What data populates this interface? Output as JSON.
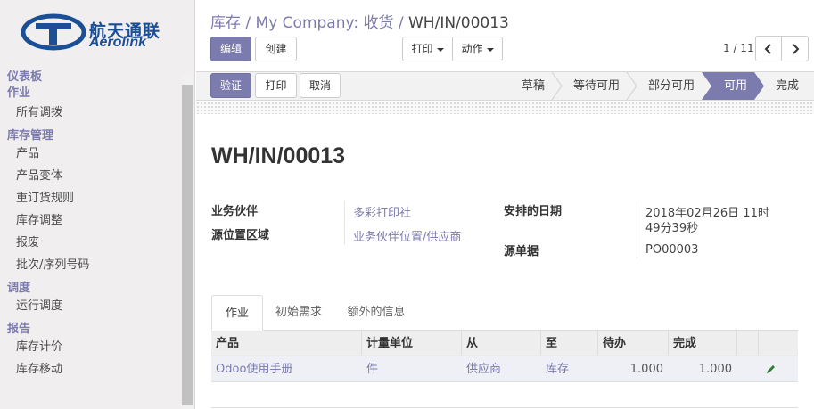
{
  "logo": {
    "cn": "航天通联",
    "en": "Aerolink"
  },
  "sidebar": {
    "sections": [
      {
        "title": "仪表板",
        "items": []
      },
      {
        "title": "作业",
        "items": [
          "所有调拨"
        ]
      },
      {
        "title": "库存管理",
        "items": [
          "产品",
          "产品变体",
          "重订货规则",
          "库存调整",
          "报废",
          "批次/序列号码"
        ]
      },
      {
        "title": "调度",
        "items": [
          "运行调度"
        ]
      },
      {
        "title": "报告",
        "items": [
          "库存计价",
          "库存移动"
        ]
      }
    ]
  },
  "breadcrumb": {
    "part1": "库存",
    "sep": "/",
    "part2": "My Company: 收货",
    "current": "WH/IN/00013"
  },
  "toolbar": {
    "edit": "编辑",
    "create": "创建",
    "print": "打印",
    "action": "动作",
    "pager": "1 / 11"
  },
  "statusbar": {
    "validate": "验证",
    "print": "打印",
    "cancel": "取消",
    "stages": [
      "草稿",
      "等待可用",
      "部分可用",
      "可用",
      "完成"
    ],
    "active_stage": "可用"
  },
  "record": {
    "name": "WH/IN/00013",
    "partner_label": "业务伙伴",
    "partner": "多彩打印社",
    "source_loc_label": "源位置区域",
    "source_loc": "业务伙伴位置/供应商",
    "scheduled_label": "安排的日期",
    "scheduled_line1": "2018年02月26日 11时",
    "scheduled_line2": "49分39秒",
    "origin_label": "源单据",
    "origin": "PO00003"
  },
  "tabs": [
    "作业",
    "初始需求",
    "额外的信息"
  ],
  "table": {
    "headers": [
      "产品",
      "计量单位",
      "从",
      "至",
      "待办",
      "完成"
    ],
    "rows": [
      {
        "product": "Odoo使用手册",
        "uom": "件",
        "from": "供应商",
        "to": "库存",
        "todo": "1.000",
        "done": "1.000"
      }
    ]
  },
  "colors": {
    "brand": "#7c7bad",
    "logo": "#1a4f96"
  }
}
